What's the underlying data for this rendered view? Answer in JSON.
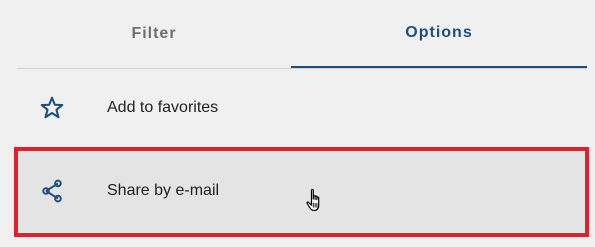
{
  "tabs": [
    {
      "label": "Filter",
      "active": false
    },
    {
      "label": "Options",
      "active": true
    }
  ],
  "menu": {
    "items": [
      {
        "label": "Add to favorites",
        "icon": "star-outline-icon"
      },
      {
        "label": "Share by e-mail",
        "icon": "share-icon",
        "highlighted": true
      }
    ]
  },
  "colors": {
    "accent": "#1f4e79",
    "inactive_tab": "#6f6f6f",
    "highlight_frame": "#e0202a",
    "background": "#f0f0f0",
    "hover_row": "#e4e4e4"
  }
}
